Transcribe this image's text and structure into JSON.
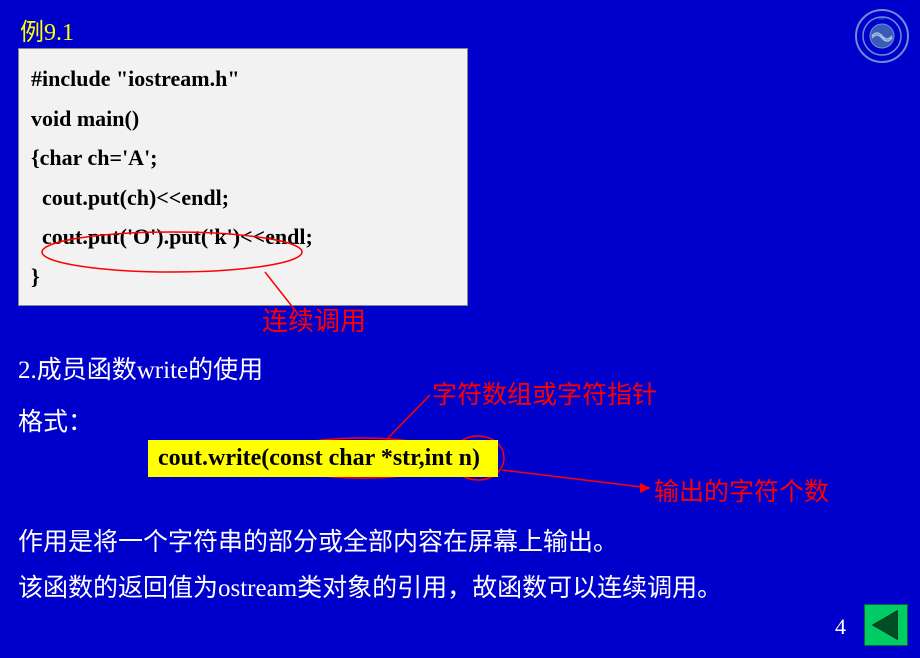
{
  "title": "例9.1",
  "code": {
    "line1": "#include \"iostream.h\"",
    "line2": "void main()",
    "line3": "{char ch='A';",
    "line4": "  cout.put(ch)<<endl;",
    "line5": "  cout.put('O').put('k')<<endl;",
    "line6": "}"
  },
  "chaining_label": "连续调用",
  "section2_heading": "2.成员函数write的使用",
  "format_label": "格式：",
  "highlighted_code": "cout.write(const char *str,int n)",
  "annotation_ptr": "字符数组或字符指针",
  "annotation_count": "输出的字符个数",
  "description1": "作用是将一个字符串的部分或全部内容在屏幕上输出。",
  "description2": "该函数的返回值为ostream类对象的引用，故函数可以连续调用。",
  "page_number": "4"
}
